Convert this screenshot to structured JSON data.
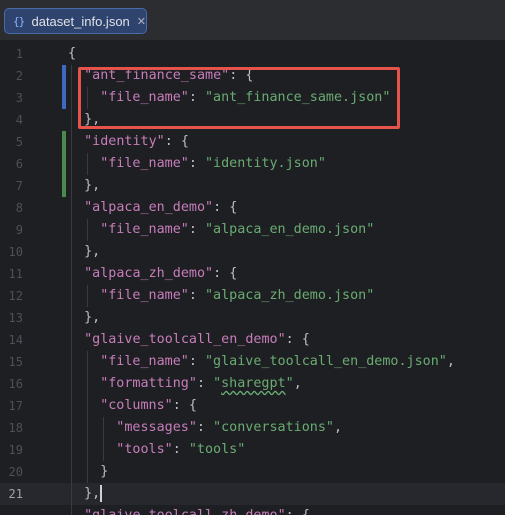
{
  "tab": {
    "icon": "json-braces-icon",
    "icon_glyph": "{}",
    "label": "dataset_info.json",
    "close_glyph": "✕"
  },
  "lines": [
    {
      "n": "1",
      "indent": 0,
      "tokens": [
        {
          "t": "p",
          "v": "{"
        }
      ]
    },
    {
      "n": "2",
      "indent": 1,
      "tokens": [
        {
          "t": "k",
          "v": "\"ant_finance_same\""
        },
        {
          "t": "p",
          "v": ": {"
        }
      ]
    },
    {
      "n": "3",
      "indent": 2,
      "tokens": [
        {
          "t": "k",
          "v": "\"file_name\""
        },
        {
          "t": "p",
          "v": ": "
        },
        {
          "t": "s",
          "v": "\"ant_finance_same.json\""
        }
      ]
    },
    {
      "n": "4",
      "indent": 1,
      "tokens": [
        {
          "t": "p",
          "v": "},"
        }
      ]
    },
    {
      "n": "5",
      "indent": 1,
      "tokens": [
        {
          "t": "k",
          "v": "\"identity\""
        },
        {
          "t": "p",
          "v": ": {"
        }
      ]
    },
    {
      "n": "6",
      "indent": 2,
      "tokens": [
        {
          "t": "k",
          "v": "\"file_name\""
        },
        {
          "t": "p",
          "v": ": "
        },
        {
          "t": "s",
          "v": "\"identity.json\""
        }
      ]
    },
    {
      "n": "7",
      "indent": 1,
      "tokens": [
        {
          "t": "p",
          "v": "},"
        }
      ]
    },
    {
      "n": "8",
      "indent": 1,
      "tokens": [
        {
          "t": "k",
          "v": "\"alpaca_en_demo\""
        },
        {
          "t": "p",
          "v": ": {"
        }
      ]
    },
    {
      "n": "9",
      "indent": 2,
      "tokens": [
        {
          "t": "k",
          "v": "\"file_name\""
        },
        {
          "t": "p",
          "v": ": "
        },
        {
          "t": "s",
          "v": "\"alpaca_en_demo.json\""
        }
      ]
    },
    {
      "n": "10",
      "indent": 1,
      "tokens": [
        {
          "t": "p",
          "v": "},"
        }
      ]
    },
    {
      "n": "11",
      "indent": 1,
      "tokens": [
        {
          "t": "k",
          "v": "\"alpaca_zh_demo\""
        },
        {
          "t": "p",
          "v": ": {"
        }
      ]
    },
    {
      "n": "12",
      "indent": 2,
      "tokens": [
        {
          "t": "k",
          "v": "\"file_name\""
        },
        {
          "t": "p",
          "v": ": "
        },
        {
          "t": "s",
          "v": "\"alpaca_zh_demo.json\""
        }
      ]
    },
    {
      "n": "13",
      "indent": 1,
      "tokens": [
        {
          "t": "p",
          "v": "},"
        }
      ]
    },
    {
      "n": "14",
      "indent": 1,
      "tokens": [
        {
          "t": "k",
          "v": "\"glaive_toolcall_en_demo\""
        },
        {
          "t": "p",
          "v": ": {"
        }
      ]
    },
    {
      "n": "15",
      "indent": 2,
      "tokens": [
        {
          "t": "k",
          "v": "\"file_name\""
        },
        {
          "t": "p",
          "v": ": "
        },
        {
          "t": "s",
          "v": "\"glaive_toolcall_en_demo.json\""
        },
        {
          "t": "p",
          "v": ","
        }
      ]
    },
    {
      "n": "16",
      "indent": 2,
      "tokens": [
        {
          "t": "k",
          "v": "\"formatting\""
        },
        {
          "t": "p",
          "v": ": "
        },
        {
          "t": "s",
          "v": "\""
        },
        {
          "t": "sw",
          "v": "sharegpt"
        },
        {
          "t": "s",
          "v": "\""
        },
        {
          "t": "p",
          "v": ","
        }
      ]
    },
    {
      "n": "17",
      "indent": 2,
      "tokens": [
        {
          "t": "k",
          "v": "\"columns\""
        },
        {
          "t": "p",
          "v": ": {"
        }
      ]
    },
    {
      "n": "18",
      "indent": 3,
      "tokens": [
        {
          "t": "k",
          "v": "\"messages\""
        },
        {
          "t": "p",
          "v": ": "
        },
        {
          "t": "s",
          "v": "\"conversations\""
        },
        {
          "t": "p",
          "v": ","
        }
      ]
    },
    {
      "n": "19",
      "indent": 3,
      "tokens": [
        {
          "t": "k",
          "v": "\"tools\""
        },
        {
          "t": "p",
          "v": ": "
        },
        {
          "t": "s",
          "v": "\"tools\""
        }
      ]
    },
    {
      "n": "20",
      "indent": 2,
      "tokens": [
        {
          "t": "p",
          "v": "}"
        }
      ]
    },
    {
      "n": "21",
      "indent": 1,
      "current": true,
      "tokens": [
        {
          "t": "p",
          "v": "},"
        }
      ]
    },
    {
      "n": "",
      "indent": 1,
      "tokens": [
        {
          "t": "k",
          "v": "\"glaive_toolcall_zh_demo\""
        },
        {
          "t": "p",
          "v": ": {"
        }
      ]
    }
  ],
  "colors": {
    "key": "#c77dbb",
    "string": "#6aab73",
    "punct": "#bcbec4",
    "modified_bar": "#3d6ac0",
    "added_bar": "#4a8a4f",
    "highlight_box": "#e5534b"
  }
}
